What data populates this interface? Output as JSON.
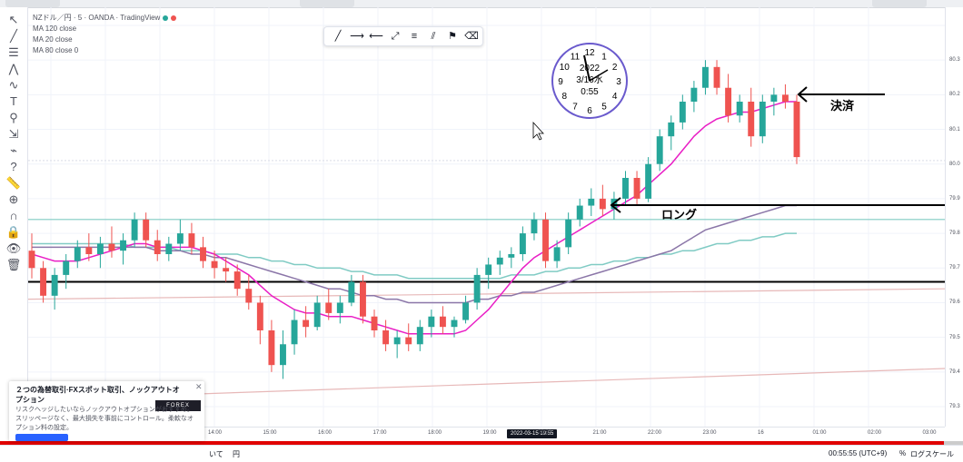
{
  "window": {
    "top_tabs": [
      "",
      "",
      ""
    ]
  },
  "legend": {
    "symbol": "NZドル／円 · 5 · OANDA · TradingView",
    "indicators": [
      "MA 120 close",
      "MA 20 close",
      "MA 80 close 0"
    ]
  },
  "toolbar": {
    "tools": [
      "cursor-icon",
      "trendline-icon",
      "horizontal-lines-icon",
      "pitchfork-icon",
      "brush-icon",
      "text-icon",
      "pattern-icon",
      "measure-icon",
      "forecast-icon",
      "help-icon",
      "ruler-icon",
      "zoom-icon",
      "magnet-icon",
      "lock-icon",
      "eye-icon",
      "trash-icon"
    ]
  },
  "drawing_toolbar": {
    "tools": [
      "trendline-icon",
      "ray-icon",
      "horizontal-ray-icon",
      "extended-line-icon",
      "parallel-channel-icon",
      "pitchfork-icon",
      "flag-icon",
      "eraser-icon"
    ]
  },
  "clock": {
    "numbers": [
      "12",
      "1",
      "2",
      "3",
      "4",
      "5",
      "6",
      "7",
      "8",
      "9",
      "10",
      "11"
    ],
    "center_text": [
      "2022",
      "3/16水",
      "0:55"
    ]
  },
  "annotations": {
    "settle": "決済",
    "long": "ロング"
  },
  "price_scale": {
    "ticks": [
      "80.3",
      "80.2",
      "80.1",
      "80.0",
      "79.9",
      "79.8",
      "79.7",
      "79.6",
      "79.5",
      "79.4",
      "79.3"
    ]
  },
  "time_scale": {
    "ticks": [
      "14:00",
      "15:00",
      "16:00",
      "17:00",
      "18:00",
      "19:00",
      "20:00",
      "21:00",
      "22:00",
      "23:00",
      "16",
      "01:00",
      "02:00",
      "03:00"
    ],
    "cursor_label": "2022-03-15 19:55"
  },
  "ad": {
    "title": "２つの為替取引·FXスポット取引、ノックアウトオプション",
    "body": "リスクヘッジしたいならノックアウトオプションがおすすめ。スリッページなく、最大損失を事前にコントロール。柔軟なオプション料の設定。",
    "logo": "FOREX",
    "button": ""
  },
  "status_bar": {
    "left": "いて",
    "left2": "円",
    "time": "00:55:55 (UTC+9)",
    "percent": "%",
    "log": "ログスケール"
  },
  "video": {
    "progress": 0.98
  },
  "colors": {
    "up": "#26a69a",
    "down": "#ef5350",
    "ma_fast": "#e91ec5",
    "ma_mid": "#8b76a8",
    "ma_slow": "#80cbc4",
    "progress": "#e00000"
  },
  "chart_data": {
    "type": "candlestick",
    "symbol": "NZDJPY",
    "timeframe": "5",
    "ylim": [
      79.3,
      80.4
    ],
    "candles": [
      {
        "o": 79.75,
        "h": 79.8,
        "l": 79.67,
        "c": 79.7
      },
      {
        "o": 79.7,
        "h": 79.72,
        "l": 79.6,
        "c": 79.62
      },
      {
        "o": 79.62,
        "h": 79.7,
        "l": 79.58,
        "c": 79.68
      },
      {
        "o": 79.68,
        "h": 79.74,
        "l": 79.64,
        "c": 79.72
      },
      {
        "o": 79.72,
        "h": 79.78,
        "l": 79.7,
        "c": 79.76
      },
      {
        "o": 79.76,
        "h": 79.8,
        "l": 79.72,
        "c": 79.74
      },
      {
        "o": 79.74,
        "h": 79.79,
        "l": 79.7,
        "c": 79.77
      },
      {
        "o": 79.77,
        "h": 79.82,
        "l": 79.73,
        "c": 79.75
      },
      {
        "o": 79.75,
        "h": 79.8,
        "l": 79.71,
        "c": 79.78
      },
      {
        "o": 79.78,
        "h": 79.86,
        "l": 79.76,
        "c": 79.84
      },
      {
        "o": 79.84,
        "h": 79.86,
        "l": 79.76,
        "c": 79.78
      },
      {
        "o": 79.78,
        "h": 79.81,
        "l": 79.72,
        "c": 79.74
      },
      {
        "o": 79.74,
        "h": 79.79,
        "l": 79.72,
        "c": 79.77
      },
      {
        "o": 79.77,
        "h": 79.84,
        "l": 79.75,
        "c": 79.8
      },
      {
        "o": 79.8,
        "h": 79.83,
        "l": 79.74,
        "c": 79.76
      },
      {
        "o": 79.76,
        "h": 79.79,
        "l": 79.7,
        "c": 79.72
      },
      {
        "o": 79.72,
        "h": 79.75,
        "l": 79.67,
        "c": 79.7
      },
      {
        "o": 79.7,
        "h": 79.73,
        "l": 79.66,
        "c": 79.69
      },
      {
        "o": 79.69,
        "h": 79.71,
        "l": 79.62,
        "c": 79.64
      },
      {
        "o": 79.64,
        "h": 79.68,
        "l": 79.58,
        "c": 79.6
      },
      {
        "o": 79.6,
        "h": 79.62,
        "l": 79.48,
        "c": 79.52
      },
      {
        "o": 79.52,
        "h": 79.55,
        "l": 79.4,
        "c": 79.42
      },
      {
        "o": 79.42,
        "h": 79.52,
        "l": 79.38,
        "c": 79.48
      },
      {
        "o": 79.48,
        "h": 79.58,
        "l": 79.45,
        "c": 79.55
      },
      {
        "o": 79.55,
        "h": 79.59,
        "l": 79.5,
        "c": 79.53
      },
      {
        "o": 79.53,
        "h": 79.62,
        "l": 79.52,
        "c": 79.6
      },
      {
        "o": 79.6,
        "h": 79.64,
        "l": 79.55,
        "c": 79.57
      },
      {
        "o": 79.57,
        "h": 79.62,
        "l": 79.54,
        "c": 79.6
      },
      {
        "o": 79.6,
        "h": 79.68,
        "l": 79.59,
        "c": 79.66
      },
      {
        "o": 79.66,
        "h": 79.68,
        "l": 79.54,
        "c": 79.56
      },
      {
        "o": 79.56,
        "h": 79.58,
        "l": 79.5,
        "c": 79.52
      },
      {
        "o": 79.52,
        "h": 79.55,
        "l": 79.46,
        "c": 79.48
      },
      {
        "o": 79.48,
        "h": 79.52,
        "l": 79.44,
        "c": 79.5
      },
      {
        "o": 79.5,
        "h": 79.54,
        "l": 79.46,
        "c": 79.48
      },
      {
        "o": 79.48,
        "h": 79.55,
        "l": 79.46,
        "c": 79.53
      },
      {
        "o": 79.53,
        "h": 79.58,
        "l": 79.5,
        "c": 79.56
      },
      {
        "o": 79.56,
        "h": 79.59,
        "l": 79.51,
        "c": 79.53
      },
      {
        "o": 79.53,
        "h": 79.56,
        "l": 79.5,
        "c": 79.55
      },
      {
        "o": 79.55,
        "h": 79.62,
        "l": 79.54,
        "c": 79.6
      },
      {
        "o": 79.6,
        "h": 79.7,
        "l": 79.58,
        "c": 79.68
      },
      {
        "o": 79.68,
        "h": 79.73,
        "l": 79.64,
        "c": 79.71
      },
      {
        "o": 79.71,
        "h": 79.75,
        "l": 79.68,
        "c": 79.73
      },
      {
        "o": 79.73,
        "h": 79.76,
        "l": 79.7,
        "c": 79.74
      },
      {
        "o": 79.74,
        "h": 79.82,
        "l": 79.72,
        "c": 79.8
      },
      {
        "o": 79.8,
        "h": 79.86,
        "l": 79.78,
        "c": 79.84
      },
      {
        "o": 79.84,
        "h": 79.86,
        "l": 79.7,
        "c": 79.72
      },
      {
        "o": 79.72,
        "h": 79.78,
        "l": 79.7,
        "c": 79.76
      },
      {
        "o": 79.76,
        "h": 79.86,
        "l": 79.74,
        "c": 79.84
      },
      {
        "o": 79.84,
        "h": 79.9,
        "l": 79.82,
        "c": 79.88
      },
      {
        "o": 79.88,
        "h": 79.93,
        "l": 79.85,
        "c": 79.9
      },
      {
        "o": 79.9,
        "h": 79.94,
        "l": 79.85,
        "c": 79.87
      },
      {
        "o": 79.87,
        "h": 79.92,
        "l": 79.84,
        "c": 79.9
      },
      {
        "o": 79.9,
        "h": 79.98,
        "l": 79.88,
        "c": 79.96
      },
      {
        "o": 79.96,
        "h": 79.98,
        "l": 79.88,
        "c": 79.9
      },
      {
        "o": 79.9,
        "h": 80.02,
        "l": 79.89,
        "c": 80.0
      },
      {
        "o": 80.0,
        "h": 80.1,
        "l": 79.98,
        "c": 80.08
      },
      {
        "o": 80.08,
        "h": 80.14,
        "l": 80.04,
        "c": 80.12
      },
      {
        "o": 80.12,
        "h": 80.2,
        "l": 80.1,
        "c": 80.18
      },
      {
        "o": 80.18,
        "h": 80.24,
        "l": 80.15,
        "c": 80.22
      },
      {
        "o": 80.22,
        "h": 80.3,
        "l": 80.2,
        "c": 80.28
      },
      {
        "o": 80.28,
        "h": 80.3,
        "l": 80.2,
        "c": 80.22
      },
      {
        "o": 80.22,
        "h": 80.26,
        "l": 80.12,
        "c": 80.14
      },
      {
        "o": 80.14,
        "h": 80.2,
        "l": 80.12,
        "c": 80.18
      },
      {
        "o": 80.18,
        "h": 80.22,
        "l": 80.05,
        "c": 80.08
      },
      {
        "o": 80.08,
        "h": 80.2,
        "l": 80.06,
        "c": 80.18
      },
      {
        "o": 80.18,
        "h": 80.22,
        "l": 80.14,
        "c": 80.2
      },
      {
        "o": 80.2,
        "h": 80.23,
        "l": 80.16,
        "c": 80.18
      },
      {
        "o": 80.18,
        "h": 80.2,
        "l": 80.0,
        "c": 80.02
      }
    ],
    "ma_20": [
      79.74,
      79.73,
      79.72,
      79.72,
      79.72,
      79.73,
      79.74,
      79.75,
      79.76,
      79.77,
      79.77,
      79.76,
      79.76,
      79.76,
      79.76,
      79.75,
      79.74,
      79.72,
      79.7,
      79.68,
      79.65,
      79.62,
      79.6,
      79.58,
      79.57,
      79.57,
      79.56,
      79.56,
      79.56,
      79.55,
      79.54,
      79.53,
      79.52,
      79.51,
      79.51,
      79.51,
      79.51,
      79.51,
      79.52,
      79.55,
      79.58,
      79.62,
      79.66,
      79.7,
      79.73,
      79.75,
      79.77,
      79.79,
      79.81,
      79.83,
      79.85,
      79.87,
      79.89,
      79.91,
      79.94,
      79.97,
      80.0,
      80.04,
      80.08,
      80.11,
      80.13,
      80.14,
      80.15,
      80.15,
      80.16,
      80.17,
      80.18,
      80.18
    ],
    "ma_80": [
      79.76,
      79.76,
      79.76,
      79.76,
      79.76,
      79.76,
      79.76,
      79.76,
      79.76,
      79.76,
      79.76,
      79.75,
      79.75,
      79.75,
      79.74,
      79.74,
      79.73,
      79.73,
      79.72,
      79.71,
      79.7,
      79.69,
      79.68,
      79.67,
      79.66,
      79.65,
      79.64,
      79.64,
      79.63,
      79.62,
      79.62,
      79.61,
      79.61,
      79.6,
      79.6,
      79.6,
      79.6,
      79.6,
      79.6,
      79.61,
      79.61,
      79.62,
      79.62,
      79.63,
      79.63,
      79.64,
      79.65,
      79.66,
      79.67,
      79.68,
      79.69,
      79.7,
      79.71,
      79.72,
      79.73,
      79.74,
      79.75,
      79.77,
      79.79,
      79.81,
      79.82,
      79.83,
      79.84,
      79.85,
      79.86,
      79.87,
      79.88,
      79.88
    ],
    "ma_120": [
      79.77,
      79.77,
      79.77,
      79.77,
      79.77,
      79.77,
      79.77,
      79.77,
      79.77,
      79.76,
      79.76,
      79.76,
      79.76,
      79.75,
      79.75,
      79.75,
      79.74,
      79.74,
      79.74,
      79.73,
      79.73,
      79.72,
      79.72,
      79.71,
      79.71,
      79.7,
      79.7,
      79.7,
      79.69,
      79.69,
      79.68,
      79.68,
      79.68,
      79.67,
      79.67,
      79.67,
      79.67,
      79.67,
      79.67,
      79.67,
      79.67,
      79.67,
      79.68,
      79.68,
      79.68,
      79.69,
      79.69,
      79.7,
      79.7,
      79.71,
      79.71,
      79.72,
      79.72,
      79.73,
      79.73,
      79.74,
      79.74,
      79.75,
      79.75,
      79.76,
      79.77,
      79.77,
      79.78,
      79.78,
      79.79,
      79.79,
      79.8,
      79.8
    ],
    "horizontal_lines": [
      {
        "price": 79.66,
        "color": "#000000"
      },
      {
        "price": 79.84,
        "color": "#80cbc4"
      },
      {
        "price": 80.01,
        "color": "#e0e3eb"
      }
    ]
  }
}
